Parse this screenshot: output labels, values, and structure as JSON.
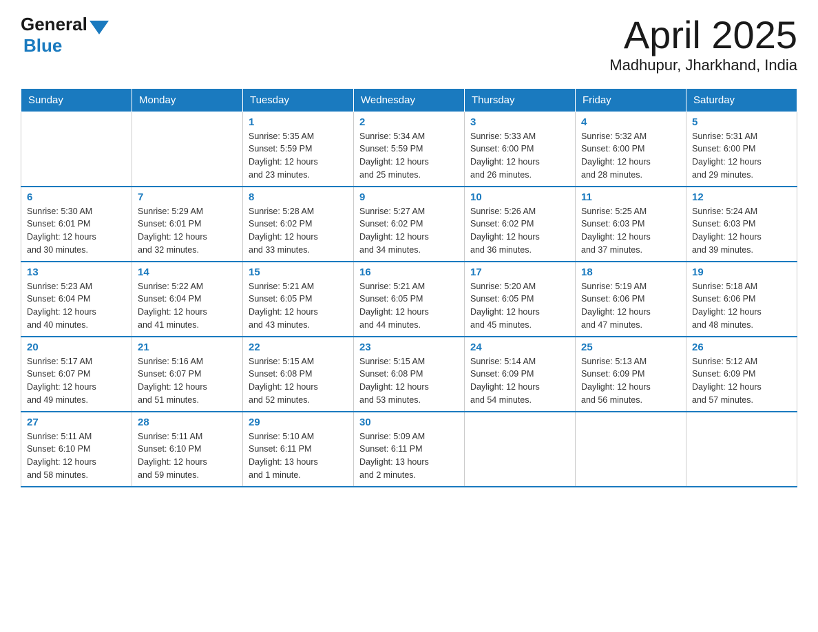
{
  "header": {
    "logo_general": "General",
    "logo_blue": "Blue",
    "title": "April 2025",
    "subtitle": "Madhupur, Jharkhand, India"
  },
  "calendar": {
    "days_of_week": [
      "Sunday",
      "Monday",
      "Tuesday",
      "Wednesday",
      "Thursday",
      "Friday",
      "Saturday"
    ],
    "weeks": [
      [
        {
          "day": "",
          "info": ""
        },
        {
          "day": "",
          "info": ""
        },
        {
          "day": "1",
          "info": "Sunrise: 5:35 AM\nSunset: 5:59 PM\nDaylight: 12 hours\nand 23 minutes."
        },
        {
          "day": "2",
          "info": "Sunrise: 5:34 AM\nSunset: 5:59 PM\nDaylight: 12 hours\nand 25 minutes."
        },
        {
          "day": "3",
          "info": "Sunrise: 5:33 AM\nSunset: 6:00 PM\nDaylight: 12 hours\nand 26 minutes."
        },
        {
          "day": "4",
          "info": "Sunrise: 5:32 AM\nSunset: 6:00 PM\nDaylight: 12 hours\nand 28 minutes."
        },
        {
          "day": "5",
          "info": "Sunrise: 5:31 AM\nSunset: 6:00 PM\nDaylight: 12 hours\nand 29 minutes."
        }
      ],
      [
        {
          "day": "6",
          "info": "Sunrise: 5:30 AM\nSunset: 6:01 PM\nDaylight: 12 hours\nand 30 minutes."
        },
        {
          "day": "7",
          "info": "Sunrise: 5:29 AM\nSunset: 6:01 PM\nDaylight: 12 hours\nand 32 minutes."
        },
        {
          "day": "8",
          "info": "Sunrise: 5:28 AM\nSunset: 6:02 PM\nDaylight: 12 hours\nand 33 minutes."
        },
        {
          "day": "9",
          "info": "Sunrise: 5:27 AM\nSunset: 6:02 PM\nDaylight: 12 hours\nand 34 minutes."
        },
        {
          "day": "10",
          "info": "Sunrise: 5:26 AM\nSunset: 6:02 PM\nDaylight: 12 hours\nand 36 minutes."
        },
        {
          "day": "11",
          "info": "Sunrise: 5:25 AM\nSunset: 6:03 PM\nDaylight: 12 hours\nand 37 minutes."
        },
        {
          "day": "12",
          "info": "Sunrise: 5:24 AM\nSunset: 6:03 PM\nDaylight: 12 hours\nand 39 minutes."
        }
      ],
      [
        {
          "day": "13",
          "info": "Sunrise: 5:23 AM\nSunset: 6:04 PM\nDaylight: 12 hours\nand 40 minutes."
        },
        {
          "day": "14",
          "info": "Sunrise: 5:22 AM\nSunset: 6:04 PM\nDaylight: 12 hours\nand 41 minutes."
        },
        {
          "day": "15",
          "info": "Sunrise: 5:21 AM\nSunset: 6:05 PM\nDaylight: 12 hours\nand 43 minutes."
        },
        {
          "day": "16",
          "info": "Sunrise: 5:21 AM\nSunset: 6:05 PM\nDaylight: 12 hours\nand 44 minutes."
        },
        {
          "day": "17",
          "info": "Sunrise: 5:20 AM\nSunset: 6:05 PM\nDaylight: 12 hours\nand 45 minutes."
        },
        {
          "day": "18",
          "info": "Sunrise: 5:19 AM\nSunset: 6:06 PM\nDaylight: 12 hours\nand 47 minutes."
        },
        {
          "day": "19",
          "info": "Sunrise: 5:18 AM\nSunset: 6:06 PM\nDaylight: 12 hours\nand 48 minutes."
        }
      ],
      [
        {
          "day": "20",
          "info": "Sunrise: 5:17 AM\nSunset: 6:07 PM\nDaylight: 12 hours\nand 49 minutes."
        },
        {
          "day": "21",
          "info": "Sunrise: 5:16 AM\nSunset: 6:07 PM\nDaylight: 12 hours\nand 51 minutes."
        },
        {
          "day": "22",
          "info": "Sunrise: 5:15 AM\nSunset: 6:08 PM\nDaylight: 12 hours\nand 52 minutes."
        },
        {
          "day": "23",
          "info": "Sunrise: 5:15 AM\nSunset: 6:08 PM\nDaylight: 12 hours\nand 53 minutes."
        },
        {
          "day": "24",
          "info": "Sunrise: 5:14 AM\nSunset: 6:09 PM\nDaylight: 12 hours\nand 54 minutes."
        },
        {
          "day": "25",
          "info": "Sunrise: 5:13 AM\nSunset: 6:09 PM\nDaylight: 12 hours\nand 56 minutes."
        },
        {
          "day": "26",
          "info": "Sunrise: 5:12 AM\nSunset: 6:09 PM\nDaylight: 12 hours\nand 57 minutes."
        }
      ],
      [
        {
          "day": "27",
          "info": "Sunrise: 5:11 AM\nSunset: 6:10 PM\nDaylight: 12 hours\nand 58 minutes."
        },
        {
          "day": "28",
          "info": "Sunrise: 5:11 AM\nSunset: 6:10 PM\nDaylight: 12 hours\nand 59 minutes."
        },
        {
          "day": "29",
          "info": "Sunrise: 5:10 AM\nSunset: 6:11 PM\nDaylight: 13 hours\nand 1 minute."
        },
        {
          "day": "30",
          "info": "Sunrise: 5:09 AM\nSunset: 6:11 PM\nDaylight: 13 hours\nand 2 minutes."
        },
        {
          "day": "",
          "info": ""
        },
        {
          "day": "",
          "info": ""
        },
        {
          "day": "",
          "info": ""
        }
      ]
    ]
  }
}
